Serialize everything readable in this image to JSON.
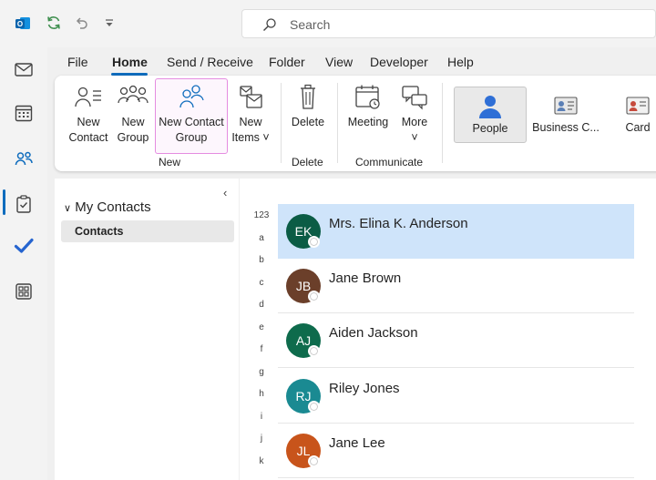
{
  "search": {
    "placeholder": "Search"
  },
  "menu": {
    "tabs": [
      "File",
      "Home",
      "Send / Receive",
      "Folder",
      "View",
      "Developer",
      "Help"
    ],
    "active": "Home"
  },
  "ribbon": {
    "new_group": {
      "label": "New",
      "new_contact": [
        "New",
        "Contact"
      ],
      "new_group": [
        "New",
        "Group"
      ],
      "new_contact_group": [
        "New Contact",
        "Group"
      ],
      "new_items": [
        "New",
        "Items ˅"
      ]
    },
    "delete_group": {
      "label": "Delete",
      "delete": "Delete"
    },
    "communicate_group": {
      "label": "Communicate",
      "meeting": "Meeting",
      "more": "More",
      "more_arrow": "˅"
    },
    "views": {
      "people": "People",
      "business_card": "Business C...",
      "card": "Card"
    }
  },
  "folders": {
    "collapse_glyph": "‹",
    "group": "My Contacts",
    "group_chevron": "∨",
    "selected_item": "Contacts"
  },
  "index_letters": [
    "123",
    "a",
    "b",
    "c",
    "d",
    "e",
    "f",
    "g",
    "h",
    "i",
    "j",
    "k"
  ],
  "contacts": [
    {
      "initials": "EK",
      "name": "Mrs. Elina K. Anderson",
      "color": "#0b5c45",
      "selected": true
    },
    {
      "initials": "JB",
      "name": "Jane Brown",
      "color": "#6b3f2a",
      "selected": false
    },
    {
      "initials": "AJ",
      "name": "Aiden Jackson",
      "color": "#0e6b4c",
      "selected": false
    },
    {
      "initials": "RJ",
      "name": "Riley Jones",
      "color": "#1a8a92",
      "selected": false
    },
    {
      "initials": "JL",
      "name": "Jane Lee",
      "color": "#c8541b",
      "selected": false
    }
  ],
  "colors": {
    "accent": "#0f6cbd",
    "selected_row": "#cfe4fa",
    "highlight_border": "#e58ce0"
  },
  "icons": {
    "app": "outlook-logo-icon",
    "sync": "sync-icon",
    "undo": "undo-icon",
    "customize": "customize-quick-access-icon",
    "rail": [
      "mail-icon",
      "calendar-icon",
      "people-icon",
      "todo-icon",
      "checkmark-icon",
      "apps-icon"
    ]
  }
}
